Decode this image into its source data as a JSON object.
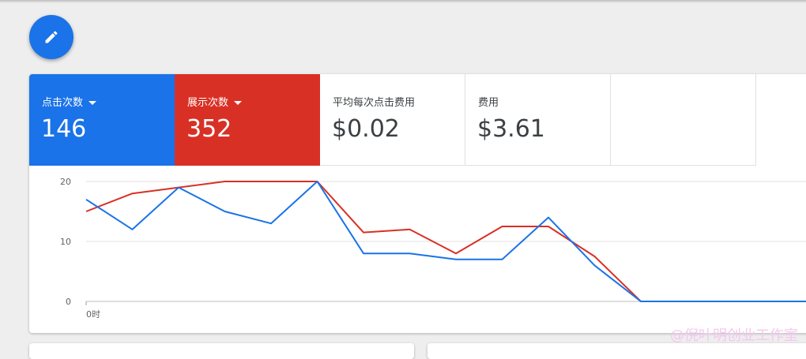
{
  "metrics": [
    {
      "label": "点击次数",
      "value": "146",
      "has_dropdown": true,
      "color": "#1a73e8"
    },
    {
      "label": "展示次数",
      "value": "352",
      "has_dropdown": true,
      "color": "#d93025"
    },
    {
      "label": "平均每次点击费用",
      "value": "$0.02",
      "has_dropdown": false
    },
    {
      "label": "费用",
      "value": "$3.61",
      "has_dropdown": false
    }
  ],
  "icons": {
    "edit": "pencil-icon"
  },
  "watermark": "@倪叶明创业工作室",
  "chart_data": {
    "type": "line",
    "x_tick_labels": [
      "0时"
    ],
    "y_ticks": [
      0,
      10,
      20
    ],
    "ylim": [
      0,
      20
    ],
    "grid": true,
    "series": [
      {
        "color": "#1a73e8",
        "values": [
          17,
          12,
          19,
          15,
          13,
          20,
          8,
          8,
          7,
          7,
          14,
          6,
          0,
          0,
          0,
          0,
          0
        ]
      },
      {
        "color": "#d93025",
        "values": [
          15,
          18,
          19,
          20,
          20,
          20,
          11.5,
          12,
          8,
          12.5,
          12.5,
          7.5,
          0,
          0,
          0,
          0,
          0
        ]
      }
    ]
  }
}
